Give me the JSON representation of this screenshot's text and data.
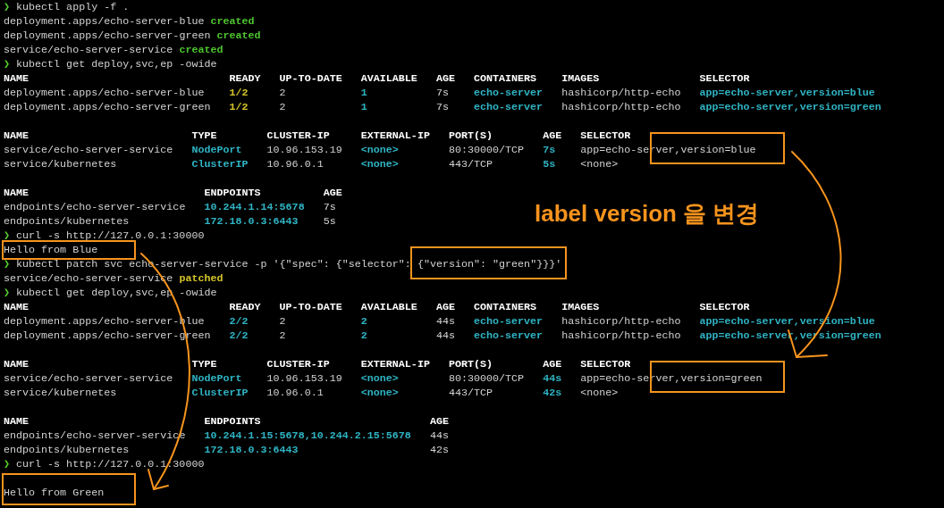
{
  "terminal": {
    "prompt": "❯",
    "blocks": [
      {
        "kind": "command",
        "command": "kubectl apply -f ."
      },
      {
        "kind": "output",
        "segments": [
          {
            "text": "deployment.apps/echo-server-blue"
          },
          {
            "text": "created",
            "color": "#4ec52e"
          }
        ]
      },
      {
        "kind": "output",
        "segments": [
          {
            "text": "deployment.apps/echo-server-green"
          },
          {
            "text": "created",
            "color": "#4ec52e"
          }
        ]
      },
      {
        "kind": "output",
        "segments": [
          {
            "text": "service/echo-server-service"
          },
          {
            "text": "created",
            "color": "#4ec52e"
          }
        ]
      },
      {
        "kind": "command",
        "command": "kubectl get deploy,svc,ep -owide"
      },
      {
        "kind": "table",
        "columns": [
          "NAME",
          "READY",
          "UP-TO-DATE",
          "AVAILABLE",
          "AGE",
          "CONTAINERS",
          "IMAGES",
          "SELECTOR"
        ],
        "rows": [
          [
            {
              "text": "deployment.apps/echo-server-blue"
            },
            {
              "text": "1/2",
              "color": "#d4c52a"
            },
            {
              "text": "2"
            },
            {
              "text": "1",
              "color": "#2fb4c4"
            },
            {
              "text": "7s"
            },
            {
              "text": "echo-server",
              "color": "#2fb4c4"
            },
            {
              "text": "hashicorp/http-echo"
            },
            {
              "text": "app=echo-server,version=blue",
              "color": "#2fb4c4"
            }
          ],
          [
            {
              "text": "deployment.apps/echo-server-green"
            },
            {
              "text": "1/2",
              "color": "#d4c52a"
            },
            {
              "text": "2"
            },
            {
              "text": "1",
              "color": "#2fb4c4"
            },
            {
              "text": "7s"
            },
            {
              "text": "echo-server",
              "color": "#2fb4c4"
            },
            {
              "text": "hashicorp/http-echo"
            },
            {
              "text": "app=echo-server,version=green",
              "color": "#2fb4c4"
            }
          ]
        ]
      },
      {
        "kind": "blank"
      },
      {
        "kind": "table",
        "columns": [
          "NAME",
          "TYPE",
          "CLUSTER-IP",
          "EXTERNAL-IP",
          "PORT(S)",
          "AGE",
          "SELECTOR"
        ],
        "rows": [
          [
            {
              "text": "service/echo-server-service"
            },
            {
              "text": "NodePort",
              "color": "#2fb4c4"
            },
            {
              "text": "10.96.153.19"
            },
            {
              "text": "<none>",
              "color": "#2fb4c4"
            },
            {
              "text": "80:30000/TCP"
            },
            {
              "text": "7s",
              "color": "#2fb4c4"
            },
            {
              "text": "app=echo-server,version=blue"
            }
          ],
          [
            {
              "text": "service/kubernetes"
            },
            {
              "text": "ClusterIP",
              "color": "#2fb4c4"
            },
            {
              "text": "10.96.0.1"
            },
            {
              "text": "<none>",
              "color": "#2fb4c4"
            },
            {
              "text": "443/TCP"
            },
            {
              "text": "5s",
              "color": "#2fb4c4"
            },
            {
              "text": "<none>"
            }
          ]
        ]
      },
      {
        "kind": "blank"
      },
      {
        "kind": "table",
        "columns": [
          "NAME",
          "ENDPOINTS",
          "AGE"
        ],
        "rows": [
          [
            {
              "text": "endpoints/echo-server-service"
            },
            {
              "text": "10.244.1.14:5678",
              "color": "#2fb4c4"
            },
            {
              "text": "7s"
            }
          ],
          [
            {
              "text": "endpoints/kubernetes"
            },
            {
              "text": "172.18.0.3:6443",
              "color": "#2fb4c4"
            },
            {
              "text": "5s"
            }
          ]
        ]
      },
      {
        "kind": "command",
        "command": "curl -s http://127.0.0.1:30000"
      },
      {
        "kind": "output",
        "segments": [
          {
            "text": "Hello from Blue"
          }
        ]
      },
      {
        "kind": "command",
        "command": "kubectl patch svc echo-server-service -p '{\"spec\": {\"selector\": {\"version\": \"green\"}}}'"
      },
      {
        "kind": "output",
        "segments": [
          {
            "text": "service/echo-server-service"
          },
          {
            "text": "patched",
            "color": "#d4c52a"
          }
        ]
      },
      {
        "kind": "command",
        "command": "kubectl get deploy,svc,ep -owide"
      },
      {
        "kind": "table",
        "columns": [
          "NAME",
          "READY",
          "UP-TO-DATE",
          "AVAILABLE",
          "AGE",
          "CONTAINERS",
          "IMAGES",
          "SELECTOR"
        ],
        "rows": [
          [
            {
              "text": "deployment.apps/echo-server-blue"
            },
            {
              "text": "2/2",
              "color": "#2fb4c4"
            },
            {
              "text": "2"
            },
            {
              "text": "2",
              "color": "#2fb4c4"
            },
            {
              "text": "44s"
            },
            {
              "text": "echo-server",
              "color": "#2fb4c4"
            },
            {
              "text": "hashicorp/http-echo"
            },
            {
              "text": "app=echo-server,version=blue",
              "color": "#2fb4c4"
            }
          ],
          [
            {
              "text": "deployment.apps/echo-server-green"
            },
            {
              "text": "2/2",
              "color": "#2fb4c4"
            },
            {
              "text": "2"
            },
            {
              "text": "2",
              "color": "#2fb4c4"
            },
            {
              "text": "44s"
            },
            {
              "text": "echo-server",
              "color": "#2fb4c4"
            },
            {
              "text": "hashicorp/http-echo"
            },
            {
              "text": "app=echo-server,version=green",
              "color": "#2fb4c4"
            }
          ]
        ]
      },
      {
        "kind": "blank"
      },
      {
        "kind": "table",
        "columns": [
          "NAME",
          "TYPE",
          "CLUSTER-IP",
          "EXTERNAL-IP",
          "PORT(S)",
          "AGE",
          "SELECTOR"
        ],
        "rows": [
          [
            {
              "text": "service/echo-server-service"
            },
            {
              "text": "NodePort",
              "color": "#2fb4c4"
            },
            {
              "text": "10.96.153.19"
            },
            {
              "text": "<none>",
              "color": "#2fb4c4"
            },
            {
              "text": "80:30000/TCP"
            },
            {
              "text": "44s",
              "color": "#2fb4c4"
            },
            {
              "text": "app=echo-server,version=green"
            }
          ],
          [
            {
              "text": "service/kubernetes"
            },
            {
              "text": "ClusterIP",
              "color": "#2fb4c4"
            },
            {
              "text": "10.96.0.1"
            },
            {
              "text": "<none>",
              "color": "#2fb4c4"
            },
            {
              "text": "443/TCP"
            },
            {
              "text": "42s",
              "color": "#2fb4c4"
            },
            {
              "text": "<none>"
            }
          ]
        ]
      },
      {
        "kind": "blank"
      },
      {
        "kind": "table",
        "columns": [
          "NAME",
          "ENDPOINTS",
          "AGE"
        ],
        "rows": [
          [
            {
              "text": "endpoints/echo-server-service"
            },
            {
              "text": "10.244.1.15:5678,10.244.2.15:5678",
              "color": "#2fb4c4"
            },
            {
              "text": "44s"
            }
          ],
          [
            {
              "text": "endpoints/kubernetes"
            },
            {
              "text": "172.18.0.3:6443",
              "color": "#2fb4c4"
            },
            {
              "text": "42s"
            }
          ]
        ]
      },
      {
        "kind": "command",
        "command": "curl -s http://127.0.0.1:30000"
      },
      {
        "kind": "blank"
      },
      {
        "kind": "output",
        "segments": [
          {
            "text": "Hello from Green"
          }
        ]
      }
    ]
  },
  "annotation": {
    "label": "label version 을 변경"
  }
}
